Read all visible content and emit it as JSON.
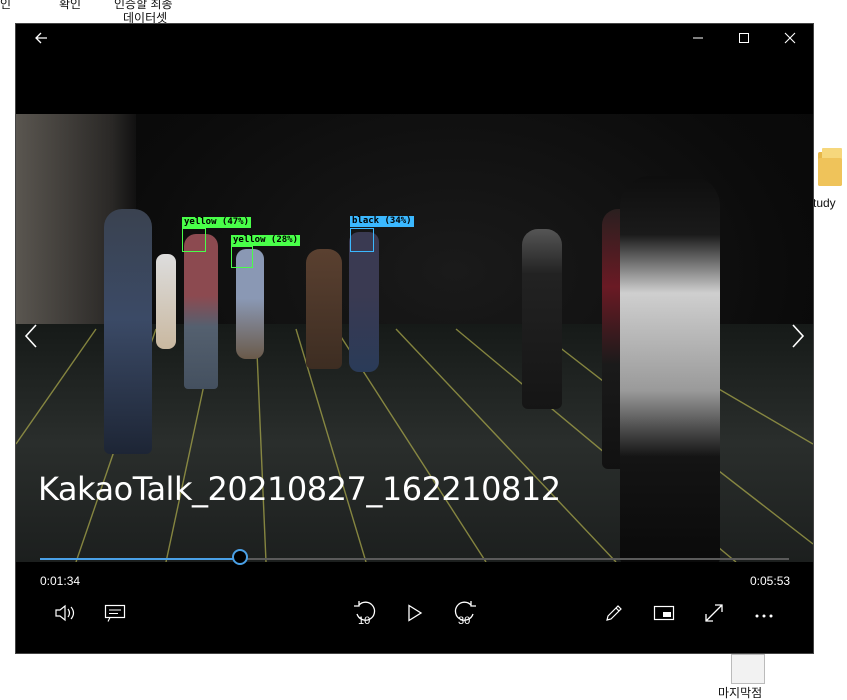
{
  "desktop": {
    "labels_top": [
      "인",
      "확인",
      "인증할 최종",
      "데이터셋"
    ],
    "folder_label": "tudy",
    "bottom_label": "마지막점"
  },
  "window": {
    "back_icon": "back-arrow-icon",
    "minimize_icon": "minimize-icon",
    "maximize_icon": "maximize-icon",
    "close_icon": "close-icon"
  },
  "video": {
    "title": "KakaoTalk_20210827_162210812",
    "detections": [
      {
        "label": "yellow (47%)"
      },
      {
        "label": "yellow (28%)"
      },
      {
        "label": "black (34%)"
      }
    ]
  },
  "player": {
    "current_time": "0:01:34",
    "total_time": "0:05:53",
    "progress": 0.267,
    "skip_back_seconds": "10",
    "skip_forward_seconds": "30",
    "accent_color": "#4aa0e6"
  }
}
